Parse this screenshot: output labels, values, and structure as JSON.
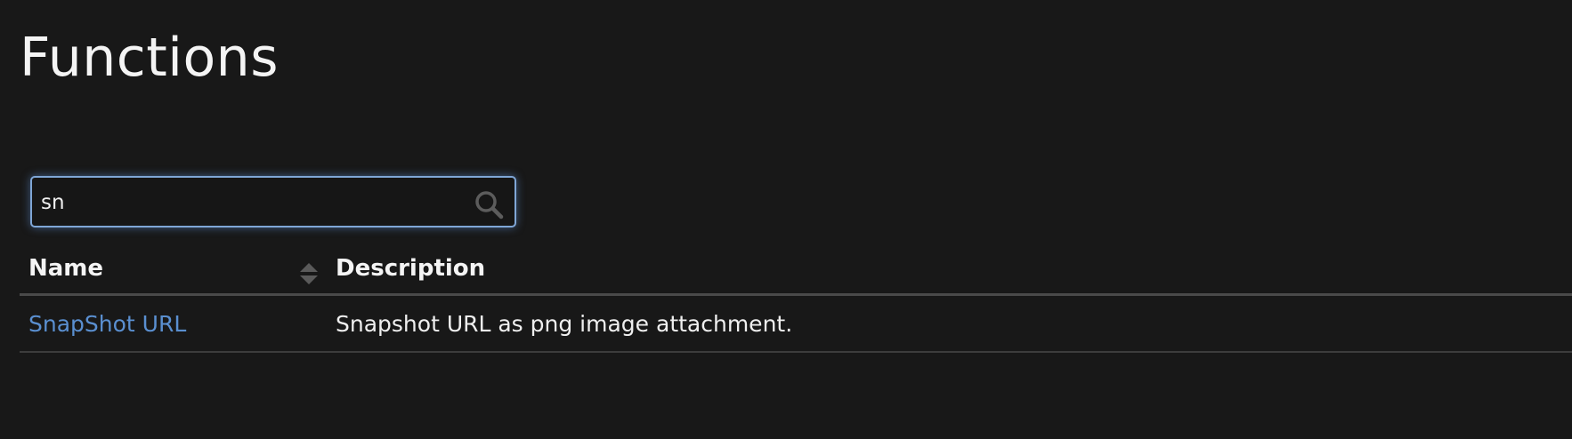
{
  "page": {
    "title": "Functions"
  },
  "search": {
    "value": "sn",
    "placeholder": ""
  },
  "table": {
    "columns": [
      {
        "label": "Name",
        "sortable": true
      },
      {
        "label": "Description",
        "sortable": false
      }
    ],
    "rows": [
      {
        "name": "SnapShot URL",
        "description": "Snapshot URL as png image attachment."
      }
    ]
  },
  "colors": {
    "background": "#181818",
    "link": "#5a8fd0",
    "focus_border": "#7fa6d6"
  },
  "icons": {
    "search": "search-icon",
    "sort": "sort-icon"
  }
}
